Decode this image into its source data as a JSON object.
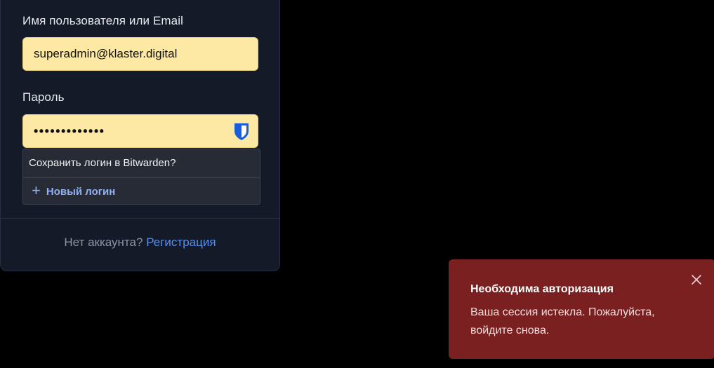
{
  "login_form": {
    "username_label": "Имя пользователя или Email",
    "username_value": "superadmin@klaster.digital",
    "password_label": "Пароль",
    "password_value": "•••••••••••••",
    "signup_prompt": "Нет аккаунта?",
    "signup_link": "Регистрация"
  },
  "bitwarden_popup": {
    "title": "Сохранить логин в Bitwarden?",
    "new_login_label": "Новый логин",
    "icon": "bitwarden-shield-icon",
    "accent_color": "#175ddc"
  },
  "toast": {
    "title": "Необходима авторизация",
    "message": "Ваша сессия истекла. Пожалуйста, войдите снова.",
    "close_icon": "close-icon",
    "background_color": "#7a2020"
  }
}
